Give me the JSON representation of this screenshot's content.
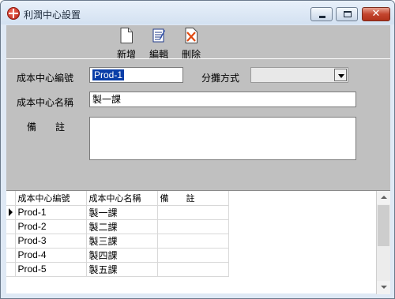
{
  "window": {
    "title": "利潤中心設置",
    "close_glyph": "✕"
  },
  "toolbar": {
    "add_label": "新增",
    "edit_label": "編輯",
    "delete_label": "刪除"
  },
  "form": {
    "code_label": "成本中心編號",
    "code_value": "Prod-1",
    "alloc_label": "分攤方式",
    "alloc_value": "",
    "name_label": "成本中心名稱",
    "name_value": "製一課",
    "remark_label": "備　　註",
    "remark_value": ""
  },
  "grid": {
    "columns": [
      "成本中心編號",
      "成本中心名稱",
      "備　　註"
    ],
    "rows": [
      {
        "code": "Prod-1",
        "name": "製一課",
        "remark": ""
      },
      {
        "code": "Prod-2",
        "name": "製二課",
        "remark": ""
      },
      {
        "code": "Prod-3",
        "name": "製三課",
        "remark": ""
      },
      {
        "code": "Prod-4",
        "name": "製四課",
        "remark": ""
      },
      {
        "code": "Prod-5",
        "name": "製五課",
        "remark": ""
      }
    ],
    "current_row": 0
  },
  "colors": {
    "selection": "#0a3ea8",
    "panel": "#c0c0c0",
    "close_button": "#c3442d"
  }
}
